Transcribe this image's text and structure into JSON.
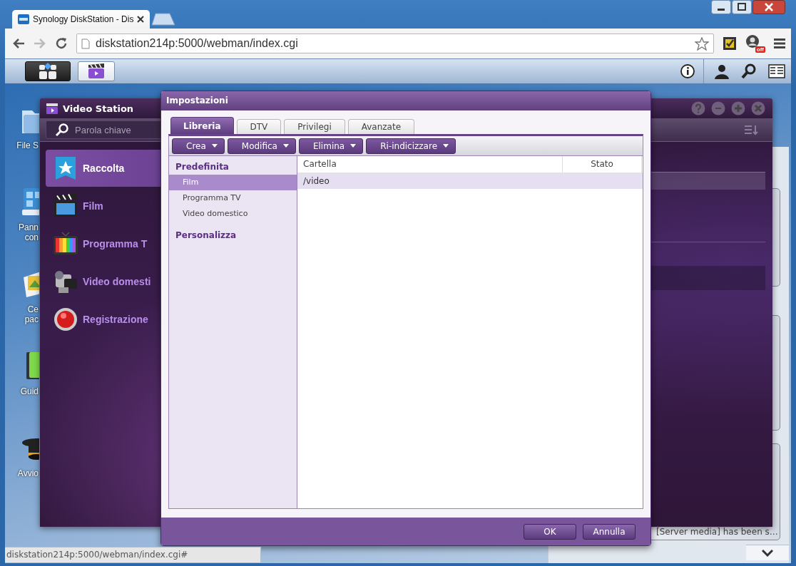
{
  "browser": {
    "tab_title": "Synology DiskStation - Dis",
    "url": "diskstation214p:5000/webman/index.cgi",
    "extension_badge": "off",
    "status_url": "diskstation214p:5000/webman/index.cgi#"
  },
  "desktop_icons": [
    {
      "kind": "folder",
      "lines": [
        "File S"
      ]
    },
    {
      "kind": "panel",
      "lines": [
        "Pann",
        "con"
      ]
    },
    {
      "kind": "package",
      "lines": [
        "Ce",
        "pac"
      ]
    },
    {
      "kind": "guide",
      "lines": [
        "Guid"
      ]
    },
    {
      "kind": "wizard",
      "lines": [
        "Avvio"
      ]
    }
  ],
  "notification": "[Server media] has been s…",
  "video_station": {
    "title": "Video Station",
    "search": {
      "placeholder": "Parola chiave"
    },
    "nav": [
      {
        "kind": "collection",
        "label": "Raccolta",
        "selected": true
      },
      {
        "kind": "movie",
        "label": "Film",
        "selected": false
      },
      {
        "kind": "tv",
        "label": "Programma T",
        "selected": false
      },
      {
        "kind": "camera",
        "label": "Video domesti",
        "selected": false
      },
      {
        "kind": "record",
        "label": "Registrazione",
        "selected": false
      }
    ]
  },
  "dialog": {
    "title": "Impostazioni",
    "tabs": [
      {
        "label": "Libreria",
        "selected": true
      },
      {
        "label": "DTV",
        "selected": false
      },
      {
        "label": "Privilegi",
        "selected": false
      },
      {
        "label": "Avanzate",
        "selected": false
      }
    ],
    "toolbar": [
      "Crea",
      "Modifica",
      "Elimina",
      "Ri-indicizzare"
    ],
    "tree": [
      {
        "label": "Predefinita",
        "selected": false,
        "children": [
          {
            "label": "Film",
            "selected": true
          },
          {
            "label": "Programma TV",
            "selected": false
          },
          {
            "label": "Video domestico",
            "selected": false
          }
        ]
      },
      {
        "label": "Personalizza",
        "selected": false
      }
    ],
    "table": {
      "columns": [
        "Cartella",
        "Stato"
      ],
      "rows": [
        {
          "cells": [
            "/video"
          ],
          "selected": true
        }
      ]
    },
    "buttons": [
      "OK",
      "Annulla"
    ]
  }
}
